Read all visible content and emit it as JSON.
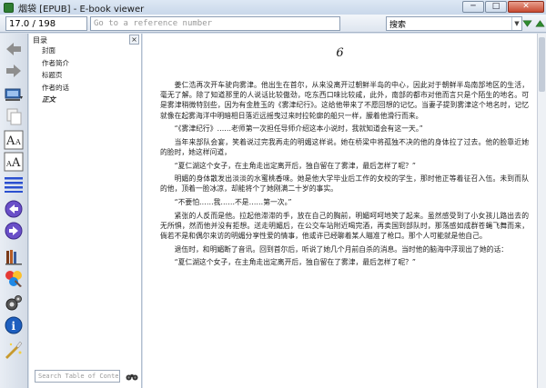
{
  "window": {
    "title": "烟袋 [EPUB] - E-book viewer",
    "min_label": "─",
    "max_label": "□",
    "close_label": "✕"
  },
  "toolbar": {
    "position_value": "17.0 / 198",
    "goto_placeholder": "Go to a reference number",
    "search_value": "搜索",
    "search_dropdown": "▼"
  },
  "side_tools": [
    {
      "icon": "back-arrow-icon"
    },
    {
      "icon": "forward-arrow-icon"
    },
    {
      "icon": "library-icon"
    },
    {
      "icon": "copy-icon"
    },
    {
      "icon": "font-size-larger-icon"
    },
    {
      "icon": "font-size-smaller-icon"
    },
    {
      "icon": "table-of-contents-icon"
    },
    {
      "icon": "previous-page-icon"
    },
    {
      "icon": "next-page-icon"
    },
    {
      "icon": "bookmark-icon"
    },
    {
      "icon": "reference-mode-icon"
    },
    {
      "icon": "preferences-icon"
    },
    {
      "icon": "metadata-icon"
    },
    {
      "icon": "print-icon"
    }
  ],
  "toc": {
    "title": "目录",
    "close_label": "×",
    "items": [
      "封面",
      "作者简介",
      "标题页",
      "作者的话",
      "正文"
    ],
    "active_index": 4,
    "search_placeholder": "Search Table of Contents"
  },
  "reader": {
    "chapter_number": "6",
    "paragraphs": [
      "姜仁浩再次开车驶向雾津。他出生在首尔，从来没离开过朝鲜半岛的中心，因此对于朝鲜半岛南部地区的生活，毫无了解。除了知道那里的人说话比较傲劲，吃东西口味比较咸，此外，南部的都市对他而言只是个陌生的地名。可是雾津稍微特别些，因为有金胜玉的《雾津纪行》。这给他带来了不愿回想的记忆。当妻子提到雾津这个地名时，记忆就像在起雾海洋中明暗相日落近远摇曳过来时拉轮廓的船只一样，朦着他滑行而来。",
      "“《雾津纪行》……老师第一次担任导师介绍这本小说时，我就知道会有这一天。”",
      "当年来部队会宴，笑着说过完我再走的明媚这样说。她在桥梁中将孤独不决的他的身体拉了过去。他的脸靠近她的脸时，她这样问道，",
      "“夏仁湖这个女子，在主角走出定离开后，独自留在了雾津，最后怎样了呢？”",
      "明媚的身体散发出淡淡的水蜜桃香味。她是他大学毕业后工作的女校的学生，那时他正等着征召入伍。未到而队的他，顶着一脸冰凉，却能将个了她刚满二十岁的事实。",
      "“不要怕……我……不是……第一次。”",
      "紧张的人反而是他。拉起他滞滞的手，放在自己的胸前，明媚呵呵地笑了起来。虽然感受到了小女孩儿路出去的无所惧，然而他并没有拒想。送走明媚后，在公交车站附近喝完酒，再卖国到部队时，那荡感如成群苍蝇飞舞而来，倘若不是和偶尔来访的明媚分享性爱的情事，他或许已经聊着某人瞄准了枪口。那个人可能就是他自己。",
      "退伍时，和明媚断了音讯。回到首尔后，听说了她几个月前自杀的消息。当时他的脑海中浮现出了她的话：",
      "“夏仁湖这个女子，在主角走出定离开后，独自留在了雾津，最后怎样了呢？”"
    ]
  }
}
